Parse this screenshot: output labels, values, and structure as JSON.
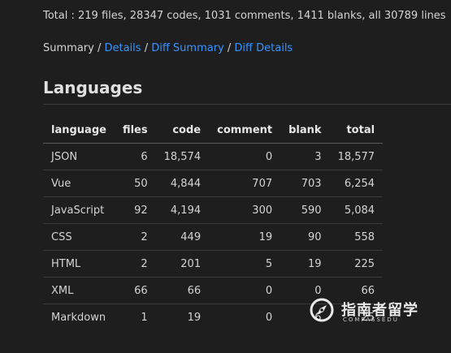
{
  "totals_text": "Total : 219 files, 28347 codes, 1031 comments, 1411 blanks, all 30789 lines",
  "nav": {
    "summary": "Summary",
    "separator": " / ",
    "details": "Details",
    "diff_summary": "Diff Summary",
    "diff_details": "Diff Details"
  },
  "section_title": "Languages",
  "table": {
    "headers": [
      "language",
      "files",
      "code",
      "comment",
      "blank",
      "total"
    ],
    "rows": [
      [
        "JSON",
        "6",
        "18,574",
        "0",
        "3",
        "18,577"
      ],
      [
        "Vue",
        "50",
        "4,844",
        "707",
        "703",
        "6,254"
      ],
      [
        "JavaScript",
        "92",
        "4,194",
        "300",
        "590",
        "5,084"
      ],
      [
        "CSS",
        "2",
        "449",
        "19",
        "90",
        "558"
      ],
      [
        "HTML",
        "2",
        "201",
        "5",
        "19",
        "225"
      ],
      [
        "XML",
        "66",
        "66",
        "0",
        "0",
        "66"
      ],
      [
        "Markdown",
        "1",
        "19",
        "0",
        "6",
        "25"
      ]
    ]
  },
  "watermark": {
    "title": "指南者留学",
    "subtitle": "COMPASSEDU",
    "logo_icon": "compass-logo-icon"
  },
  "colors": {
    "background": "#1e1e1e",
    "link": "#3794ff",
    "text": "#d4d4d4"
  }
}
